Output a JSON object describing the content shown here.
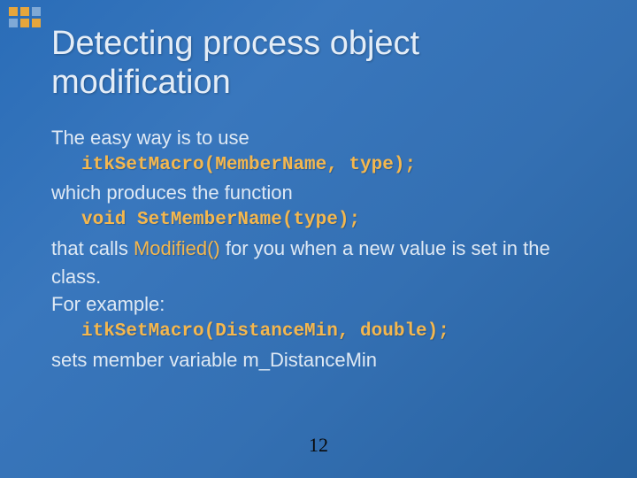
{
  "title": "Detecting process object modification",
  "body": {
    "line1": "The easy way is to use",
    "code1": "itkSetMacro(MemberName, type);",
    "line2": "which produces the function",
    "code2": "void SetMemberName(type);",
    "line3a": "that calls ",
    "modified": "Modified()",
    "line3b": " for you when a new value is set in the class.",
    "line4": "For example:",
    "code3": "itkSetMacro(DistanceMin, double);",
    "line5": "sets member variable m_DistanceMin"
  },
  "page_number": "12"
}
